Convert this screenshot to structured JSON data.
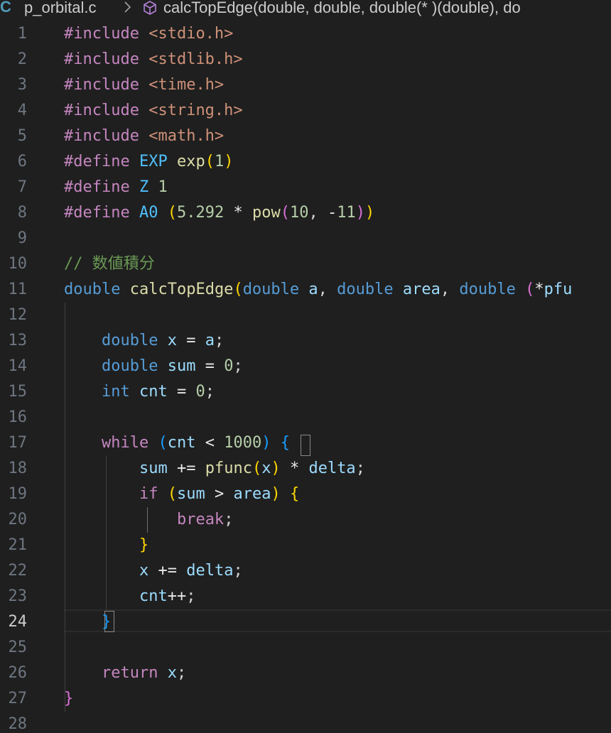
{
  "breadcrumb": {
    "language_icon": "C",
    "file": "p_orbital.c",
    "separator_icon": "chevron-right-icon",
    "symbol_icon": "method-cube-icon",
    "symbol": "calcTopEdge(double, double, double(* )(double), do"
  },
  "editor": {
    "active_line": 24,
    "lines": [
      {
        "n": "1",
        "code": "#include <stdio.h>"
      },
      {
        "n": "2",
        "code": "#include <stdlib.h>"
      },
      {
        "n": "3",
        "code": "#include <time.h>"
      },
      {
        "n": "4",
        "code": "#include <string.h>"
      },
      {
        "n": "5",
        "code": "#include <math.h>"
      },
      {
        "n": "6",
        "code": "#define EXP exp(1)"
      },
      {
        "n": "7",
        "code": "#define Z 1"
      },
      {
        "n": "8",
        "code": "#define A0 (5.292 * pow(10, -11))"
      },
      {
        "n": "9",
        "code": ""
      },
      {
        "n": "10",
        "code": "// 数値積分"
      },
      {
        "n": "11",
        "code": "double calcTopEdge(double a, double area, double (*pfu"
      },
      {
        "n": "12",
        "code": ""
      },
      {
        "n": "13",
        "code": "    double x = a;"
      },
      {
        "n": "14",
        "code": "    double sum = 0;"
      },
      {
        "n": "15",
        "code": "    int cnt = 0;"
      },
      {
        "n": "16",
        "code": ""
      },
      {
        "n": "17",
        "code": "    while (cnt < 1000) {"
      },
      {
        "n": "18",
        "code": "        sum += pfunc(x) * delta;"
      },
      {
        "n": "19",
        "code": "        if (sum > area) {"
      },
      {
        "n": "20",
        "code": "            break;"
      },
      {
        "n": "21",
        "code": "        }"
      },
      {
        "n": "22",
        "code": "        x += delta;"
      },
      {
        "n": "23",
        "code": "        cnt++;"
      },
      {
        "n": "24",
        "code": "    }"
      },
      {
        "n": "25",
        "code": ""
      },
      {
        "n": "26",
        "code": "    return x;"
      },
      {
        "n": "27",
        "code": "}"
      },
      {
        "n": "28",
        "code": ""
      }
    ]
  },
  "theme": {
    "background": "#1f1f1f",
    "directive": "#c586c0",
    "string": "#ce9178",
    "type": "#569cd6",
    "macro": "#4fc1ff",
    "function": "#dcdcaa",
    "number": "#b5cea8",
    "variable": "#9cdcfe",
    "comment": "#6a9955",
    "bracket_1": "#ffd700",
    "bracket_2": "#da70d6",
    "bracket_3": "#179fff"
  }
}
